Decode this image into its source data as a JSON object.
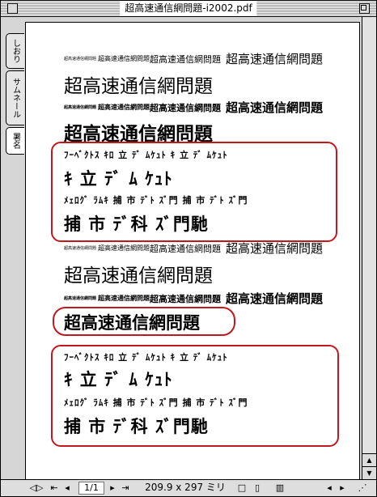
{
  "window": {
    "title": "超高速通信網問題-i2002.pdf"
  },
  "tabs": [
    {
      "label": "しおり"
    },
    {
      "label": "サムネール"
    },
    {
      "label": "署名"
    }
  ],
  "document": {
    "sample_text": "超高速通信網問題",
    "garbled_lines": [
      "ﾌｰﾍﾞｸﾄｽ ｷﾛ 立 ﾃﾞ ﾑｹｭﾄ ｷ 立 ﾃﾞ ﾑｹｭﾄ",
      "ｷ 立 ﾃﾞ ﾑ ｹｭﾄ",
      "ﾒｪﾛｸﾞ ﾗﾑｷ 捕 市 ﾃﾞﾄ ｽﾞ門 捕 市 ﾃﾞﾄ ｽﾞ門",
      "捕 市 ﾃﾞ科 ｽﾞ門馳"
    ]
  },
  "statusbar": {
    "page": "1/1",
    "page_size": "209.9 x 297 ミリ"
  },
  "colors": {
    "highlight": "#c0181c"
  }
}
